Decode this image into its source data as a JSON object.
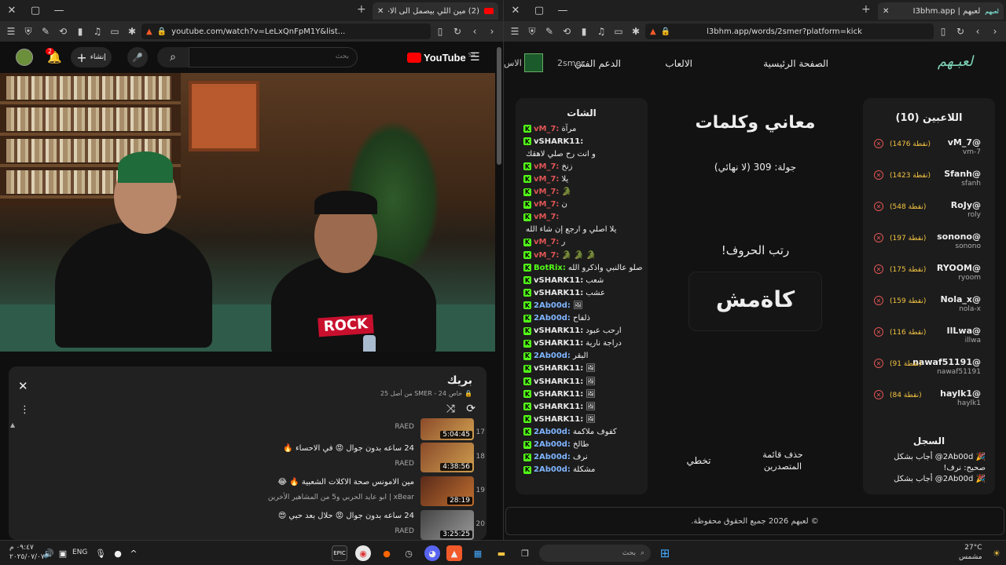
{
  "left_window": {
    "tab_title": "(2) مين اللي بيصمل الى الاخر؟",
    "url": "youtube.com/watch?v=LeLxQnFpM1Y&list...",
    "yt": {
      "logo": "YouTube",
      "region": "SA",
      "search_placeholder": "بحث",
      "create_label": "إنشاء",
      "notif_count": "2"
    },
    "playlist": {
      "title": "بريك",
      "meta": "SMER - 24 من أصل 25",
      "lock_text": "خاص",
      "items": [
        {
          "num": "17",
          "title": "",
          "channel": "RAED",
          "duration": "5:04:45"
        },
        {
          "num": "18",
          "title": "24 ساعه بدون جوال 😡 في الاحساء 🔥",
          "channel": "RAED",
          "duration": "4:38:56"
        },
        {
          "num": "19",
          "title": "مين الامونس صحة الاكلات الشعبية 🔥 😂",
          "channel": "xBear | ابو عايد الحربي و5 من المشاهير الأخرين",
          "duration": "28:19"
        },
        {
          "num": "20",
          "title": "24 ساعه بدون جوال 😡 حلال بعد حبي 😍",
          "channel": "RAED",
          "duration": "3:25:25"
        }
      ]
    }
  },
  "right_window": {
    "tab_title": "لعبهم | I3bhm.app",
    "url": "l3bhm.app/words/2smer?platform=kick",
    "nav": {
      "logo": "لعبـهم",
      "links": [
        "الصفحة الرئيسية",
        "الالعاب",
        "الدعم الفني"
      ],
      "user": "2smer",
      "cut_label": "الاس"
    },
    "players": {
      "title": "اللاعبين (10)",
      "list": [
        {
          "name": "vM_7@",
          "handle": "vm-7",
          "points": "(1476 نقطة)"
        },
        {
          "name": "Sfanh@",
          "handle": "sfanh",
          "points": "(1423 نقطة)"
        },
        {
          "name": "RoJy@",
          "handle": "roly",
          "points": "(548 نقطة)"
        },
        {
          "name": "sonono@",
          "handle": "sonono",
          "points": "(197 نقطة)"
        },
        {
          "name": "RYOOM@",
          "handle": "ryoom",
          "points": "(175 نقطة)"
        },
        {
          "name": "Nola_x@",
          "handle": "nola-x",
          "points": "(159 نقطة)"
        },
        {
          "name": "IlLwa@",
          "handle": "illwa",
          "points": "(116 نقطة)"
        },
        {
          "name": "nawaf51191@",
          "handle": "nawaf51191",
          "points": "(91 نقطة)"
        },
        {
          "name": "haylk1@",
          "handle": "haylk1",
          "points": "(84 نقطة)"
        }
      ]
    },
    "log": {
      "title": "السجل",
      "entries": [
        "2Ab00d@ أجاب بشكل",
        "صحيح: نرف!",
        "2Ab00d@ أجاب بشكل"
      ]
    },
    "game": {
      "title": "معاني وكلمات",
      "round": "جولة: 309 (لا نهائي)",
      "prompt": "رتب الحروف!",
      "scrambled": "كاةمش",
      "delete_label": "حذف قائمة المتصدرين",
      "skip_label": "تخطي"
    },
    "chat": {
      "title": "الشات",
      "messages": [
        {
          "user": "vM_7:",
          "text": "مرآة",
          "color": "#e05555"
        },
        {
          "user": "vSHARK11:",
          "text": "",
          "color": "#e8e8e8"
        },
        {
          "user": "",
          "text": "و انت رح صلي لاهقك",
          "color": "#e8e8e8"
        },
        {
          "user": "vM_7:",
          "text": "زنخ",
          "color": "#e05555"
        },
        {
          "user": "vM_7:",
          "text": "يلا",
          "color": "#e05555"
        },
        {
          "user": "vM_7:",
          "text": "🐊",
          "color": "#e05555"
        },
        {
          "user": "vM_7:",
          "text": "ن",
          "color": "#e05555"
        },
        {
          "user": "vM_7:",
          "text": "",
          "color": "#e05555"
        },
        {
          "user": "",
          "text": "يلا اصلي و ارجع إن شاء الله",
          "color": "#e8e8e8"
        },
        {
          "user": "vM_7:",
          "text": "ر",
          "color": "#e05555"
        },
        {
          "user": "vM_7:",
          "text": "🐊 🐊 🐊",
          "color": "#e05555"
        },
        {
          "user": "BotRix:",
          "text": "صلو عالنبي واذكرو الله",
          "color": "#53fc18"
        },
        {
          "user": "vSHARK11:",
          "text": "شعب",
          "color": "#e8e8e8"
        },
        {
          "user": "vSHARK11:",
          "text": "عشب",
          "color": "#e8e8e8"
        },
        {
          "user": "2Ab00d:",
          "text": "🖼",
          "color": "#7fb4ff"
        },
        {
          "user": "2Ab00d:",
          "text": "ذلفاح",
          "color": "#7fb4ff"
        },
        {
          "user": "vSHARK11:",
          "text": "ارحب عبود",
          "color": "#e8e8e8"
        },
        {
          "user": "vSHARK11:",
          "text": "دراجة نارية",
          "color": "#e8e8e8"
        },
        {
          "user": "2Ab00d:",
          "text": "البقر",
          "color": "#7fb4ff"
        },
        {
          "user": "vSHARK11:",
          "text": "🖼",
          "color": "#e8e8e8"
        },
        {
          "user": "vSHARK11:",
          "text": "🖼",
          "color": "#e8e8e8"
        },
        {
          "user": "vSHARK11:",
          "text": "🖼",
          "color": "#e8e8e8"
        },
        {
          "user": "vSHARK11:",
          "text": "🖼",
          "color": "#e8e8e8"
        },
        {
          "user": "vSHARK11:",
          "text": "🖼",
          "color": "#e8e8e8"
        },
        {
          "user": "2Ab00d:",
          "text": "كفوف ملاكمة",
          "color": "#7fb4ff"
        },
        {
          "user": "2Ab00d:",
          "text": "طالخ",
          "color": "#7fb4ff"
        },
        {
          "user": "2Ab00d:",
          "text": "نرف",
          "color": "#7fb4ff"
        },
        {
          "user": "2Ab00d:",
          "text": "مشكلة",
          "color": "#7fb4ff"
        }
      ]
    },
    "footer": "© لعبهم 2026 جميع الحقوق محفوظة."
  },
  "taskbar": {
    "weather_temp": "27°C",
    "weather_desc": "مشمس",
    "search_placeholder": "بحث",
    "lang": "ENG",
    "time": "٠٩:٤٧ م",
    "date": "٢٠٢٥/٠٧/٠٧"
  }
}
